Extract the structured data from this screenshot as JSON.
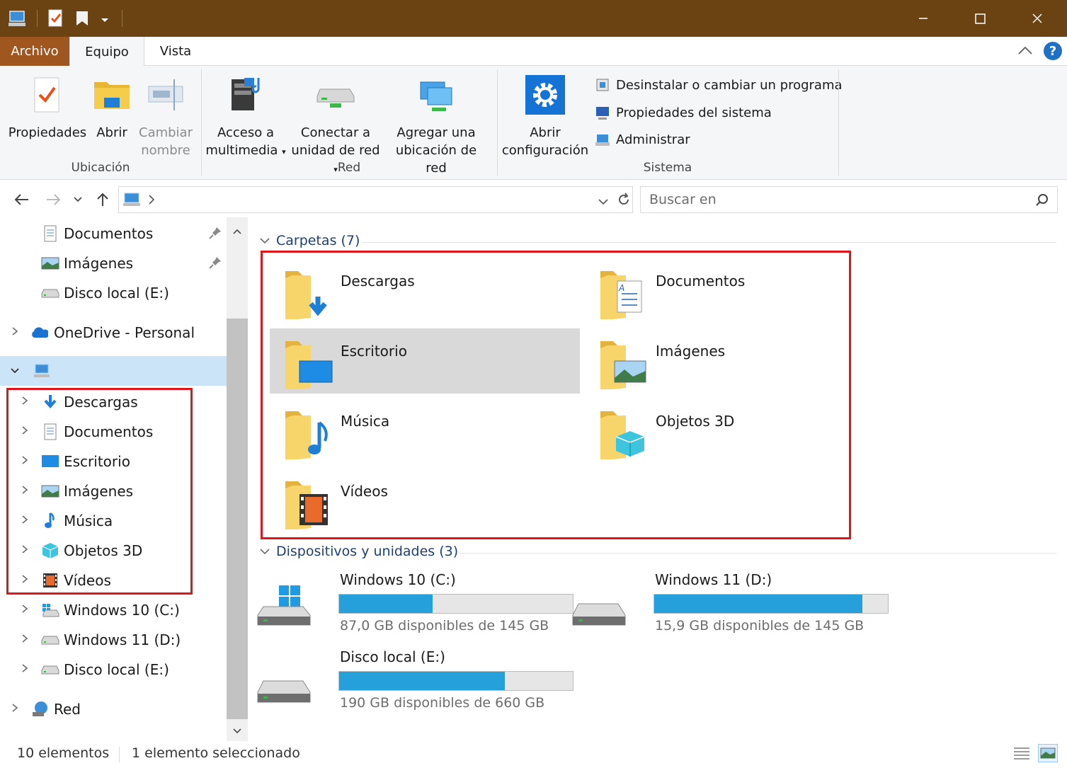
{
  "ribbon_tabs": {
    "file": "Archivo",
    "equipo": "Equipo",
    "vista": "Vista"
  },
  "ribbon": {
    "propiedades": "Propiedades",
    "abrir": "Abrir",
    "cambiar_1": "Cambiar",
    "cambiar_2": "nombre",
    "acceso_1": "Acceso a",
    "acceso_2": "multimedia",
    "conectar_1": "Conectar a",
    "conectar_2": "unidad de red",
    "agregar_1": "Agregar una",
    "agregar_2": "ubicación de red",
    "config_1": "Abrir",
    "config_2": "configuración",
    "desinstalar": "Desinstalar o cambiar un programa",
    "propiedades_sistema": "Propiedades del sistema",
    "administrar": "Administrar",
    "group_ubicacion": "Ubicación",
    "group_red": "Red",
    "group_sistema": "Sistema",
    "help": "?"
  },
  "search": {
    "placeholder": "Buscar en"
  },
  "nav": {
    "pinned": [
      {
        "label": "Documentos"
      },
      {
        "label": "Imágenes"
      },
      {
        "label": "Disco local (E:)"
      }
    ],
    "onedrive": "OneDrive - Personal",
    "this_pc_children": [
      {
        "label": "Descargas"
      },
      {
        "label": "Documentos"
      },
      {
        "label": "Escritorio"
      },
      {
        "label": "Imágenes"
      },
      {
        "label": "Música"
      },
      {
        "label": "Objetos 3D"
      },
      {
        "label": "Vídeos"
      },
      {
        "label": "Windows 10 (C:)"
      },
      {
        "label": "Windows 11 (D:)"
      },
      {
        "label": "Disco local (E:)"
      }
    ],
    "red": "Red"
  },
  "content": {
    "folders_header": "Carpetas (7)",
    "folders": [
      {
        "label": "Descargas",
        "icon": "download-folder-icon"
      },
      {
        "label": "Documentos",
        "icon": "documents-folder-icon"
      },
      {
        "label": "Escritorio",
        "icon": "desktop-folder-icon"
      },
      {
        "label": "Imágenes",
        "icon": "pictures-folder-icon"
      },
      {
        "label": "Música",
        "icon": "music-folder-icon"
      },
      {
        "label": "Objetos 3D",
        "icon": "3d-objects-folder-icon"
      },
      {
        "label": "Vídeos",
        "icon": "videos-folder-icon"
      }
    ],
    "devices_header": "Dispositivos y unidades (3)",
    "drives": [
      {
        "name": "Windows 10 (C:)",
        "info": "87,0 GB disponibles de 145 GB",
        "used_fraction": 0.4
      },
      {
        "name": "Windows 11 (D:)",
        "info": "15,9 GB disponibles de 145 GB",
        "used_fraction": 0.89
      },
      {
        "name": "Disco local (E:)",
        "info": "190 GB disponibles de 660 GB",
        "used_fraction": 0.71
      }
    ]
  },
  "status": {
    "count": "10 elementos",
    "selected": "1 elemento seleccionado"
  },
  "colors": {
    "titlebar": "#6b4212",
    "file_tab": "#a0561f",
    "drive_fill": "#26a0da",
    "highlight_box": "#e0151c",
    "nav_selected": "#cce4f7"
  }
}
